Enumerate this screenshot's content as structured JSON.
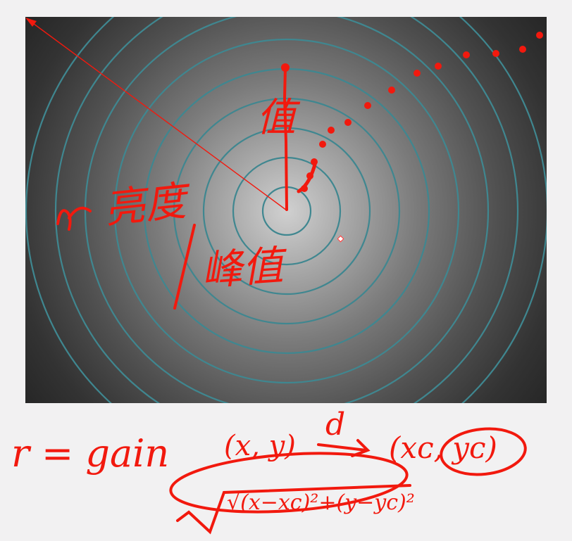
{
  "canvas": {
    "ring_color": "#3f8790",
    "ring_count": 9
  },
  "annotations": {
    "ink_color": "#f2190e",
    "label_r": "r",
    "label_r_cn": "亮度",
    "label_value": "值",
    "label_peak": "峰值",
    "formula_left": "r = gain",
    "formula_point": "(x, y)",
    "formula_arrow_label": "d",
    "formula_center": "(xᴄ, yᴄ)",
    "formula_sqrt": "√(x−xc)²+(y−yc)²"
  }
}
